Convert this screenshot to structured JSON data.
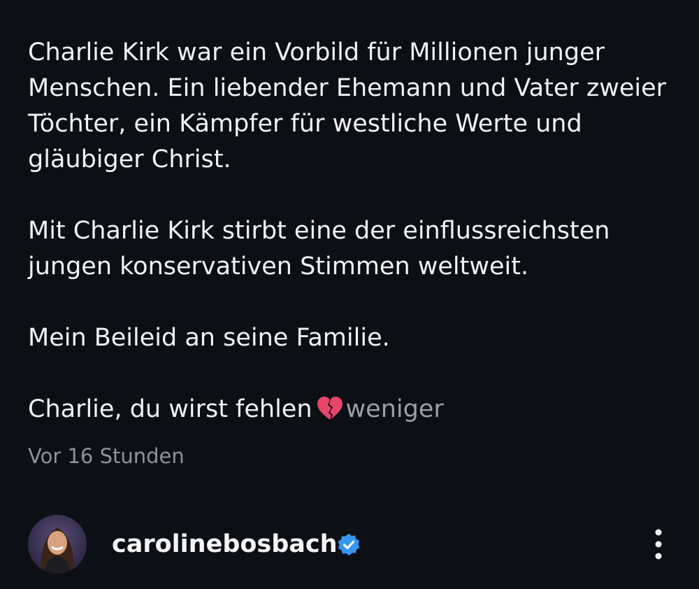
{
  "caption": {
    "paragraphs": [
      "Charlie Kirk war ein Vorbild für Millionen junger Menschen. Ein liebender Ehemann und Vater zweier Töchter, ein Kämpfer für westliche Werte und gläubiger Christ.",
      "Mit Charlie Kirk stirbt eine der einflussreichsten jungen konservativen Stimmen weltweit.",
      "Mein Beileid an seine Familie."
    ],
    "last_line": "Charlie, du wirst fehlen",
    "emoji_icon": "broken-heart-icon",
    "more_label": "weniger"
  },
  "timestamp": "Vor 16 Stunden",
  "author": {
    "username": "carolinebosbach",
    "verified_icon": "verified-badge-icon",
    "menu_icon": "more-vertical-icon"
  },
  "colors": {
    "background": "#0c0f14",
    "text": "#f2f2f2",
    "muted": "#8d939b",
    "verified": "#3797f0",
    "broken_heart": "#e8456b"
  }
}
